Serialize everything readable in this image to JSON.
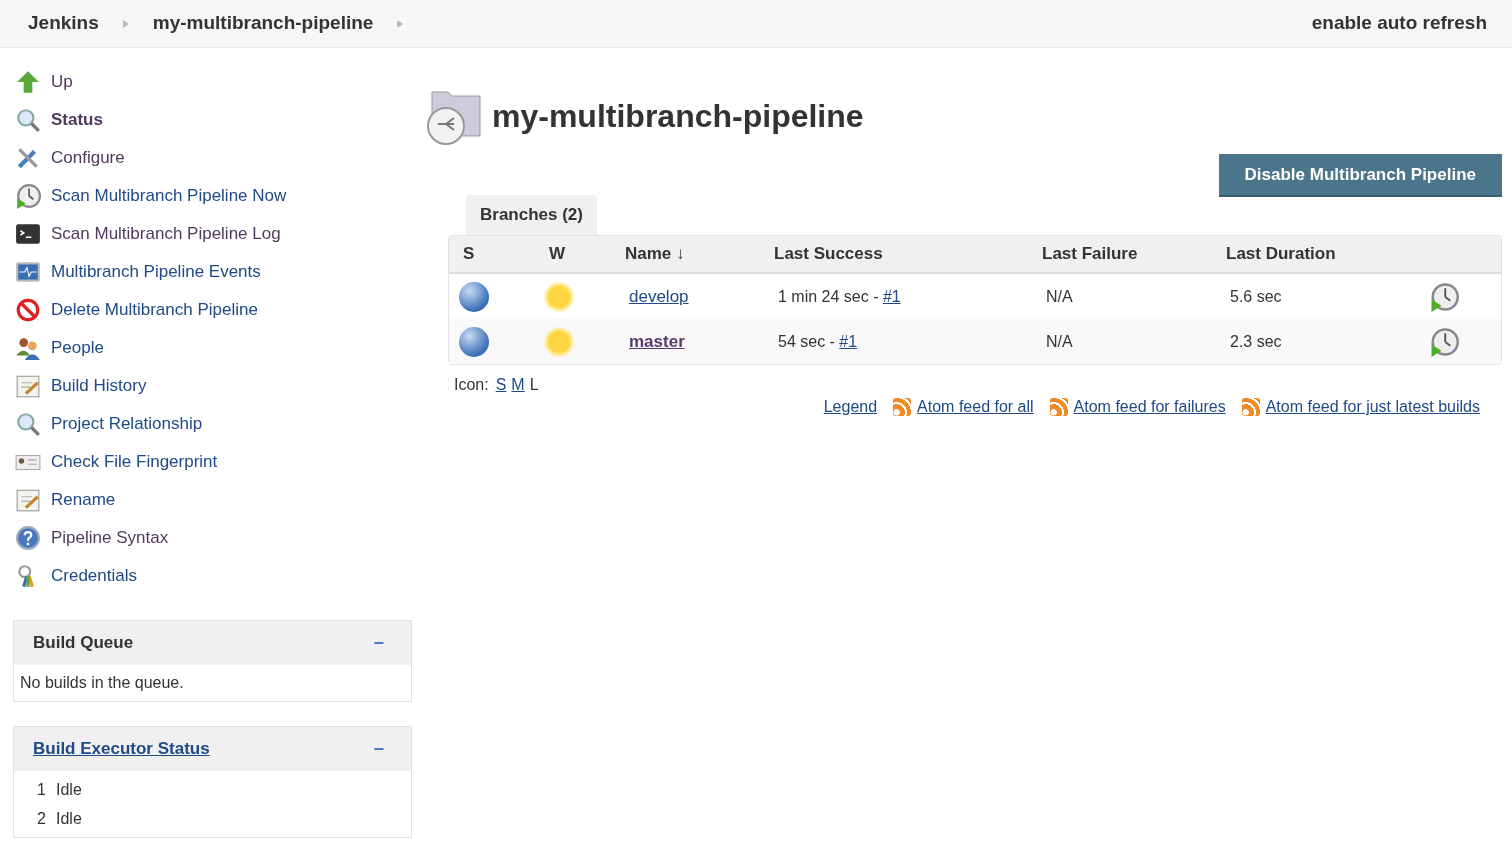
{
  "header": {
    "breadcrumbs": [
      "Jenkins",
      "my-multibranch-pipeline"
    ],
    "auto_refresh": "enable auto refresh"
  },
  "sidebar": {
    "items": [
      {
        "label": "Up",
        "kind": "up",
        "selected": false,
        "visited": true
      },
      {
        "label": "Status",
        "kind": "search",
        "selected": true,
        "visited": true
      },
      {
        "label": "Configure",
        "kind": "tools",
        "selected": false,
        "visited": true
      },
      {
        "label": "Scan Multibranch Pipeline Now",
        "kind": "clock",
        "selected": false,
        "visited": false
      },
      {
        "label": "Scan Multibranch Pipeline Log",
        "kind": "terminal",
        "selected": false,
        "visited": true
      },
      {
        "label": "Multibranch Pipeline Events",
        "kind": "monitor",
        "selected": false,
        "visited": false
      },
      {
        "label": "Delete Multibranch Pipeline",
        "kind": "delete",
        "selected": false,
        "visited": false
      },
      {
        "label": "People",
        "kind": "people",
        "selected": false,
        "visited": false
      },
      {
        "label": "Build History",
        "kind": "notepad",
        "selected": false,
        "visited": false
      },
      {
        "label": "Project Relationship",
        "kind": "search",
        "selected": false,
        "visited": false
      },
      {
        "label": "Check File Fingerprint",
        "kind": "card",
        "selected": false,
        "visited": false
      },
      {
        "label": "Rename",
        "kind": "notepad",
        "selected": false,
        "visited": false
      },
      {
        "label": "Pipeline Syntax",
        "kind": "help",
        "selected": false,
        "visited": true
      },
      {
        "label": "Credentials",
        "kind": "keys",
        "selected": false,
        "visited": false
      }
    ]
  },
  "build_queue": {
    "title": "Build Queue",
    "collapse": "−",
    "message": "No builds in the queue."
  },
  "executors": {
    "title": "Build Executor Status",
    "collapse": "−",
    "rows": [
      {
        "number": "1",
        "status": "Idle"
      },
      {
        "number": "2",
        "status": "Idle"
      }
    ]
  },
  "main": {
    "title": "my-multibranch-pipeline",
    "disable_button": "Disable Multibranch Pipeline",
    "tabs": [
      {
        "label": "Branches (2)",
        "selected": true
      }
    ],
    "table": {
      "columns": [
        "S",
        "W",
        "Name ↓",
        "Last Success",
        "Last Failure",
        "Last Duration"
      ],
      "rows": [
        {
          "name": "develop",
          "visited": false,
          "last_success": "1 min 24 sec - ",
          "build": "#1",
          "last_failure": "N/A",
          "last_duration": "5.6 sec"
        },
        {
          "name": "master",
          "visited": true,
          "last_success": "54 sec - ",
          "build": "#1",
          "last_failure": "N/A",
          "last_duration": "2.3 sec"
        }
      ]
    },
    "icon_label": "Icon:",
    "icon_sizes": [
      {
        "label": "S",
        "selected": false
      },
      {
        "label": "M",
        "selected": false
      },
      {
        "label": "L",
        "selected": true
      }
    ],
    "legend": "Legend",
    "feeds": [
      "Atom feed for all",
      "Atom feed for failures",
      "Atom feed for just latest builds"
    ]
  }
}
